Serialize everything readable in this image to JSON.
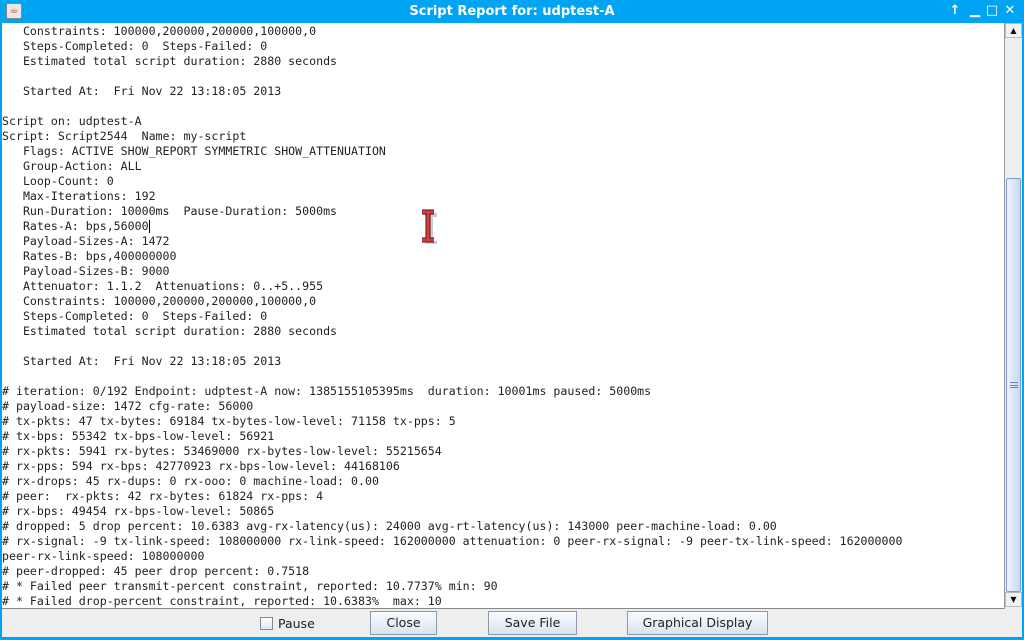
{
  "window": {
    "title": "Script Report for:  udptest-A",
    "buttons": [
      "pin",
      "minimize",
      "maximize",
      "close"
    ]
  },
  "report_lines": [
    "   Constraints: 100000,200000,200000,100000,0",
    "   Steps-Completed: 0  Steps-Failed: 0",
    "   Estimated total script duration: 2880 seconds",
    "",
    "   Started At:  Fri Nov 22 13:18:05 2013",
    "",
    "Script on: udptest-A",
    "Script: Script2544  Name: my-script",
    "   Flags: ACTIVE SHOW_REPORT SYMMETRIC SHOW_ATTENUATION",
    "   Group-Action: ALL",
    "   Loop-Count: 0",
    "   Max-Iterations: 192",
    "   Run-Duration: 10000ms  Pause-Duration: 5000ms",
    "   Rates-A: bps,56000",
    "   Payload-Sizes-A: 1472",
    "   Rates-B: bps,400000000",
    "   Payload-Sizes-B: 9000",
    "   Attenuator: 1.1.2  Attenuations: 0..+5..955",
    "   Constraints: 100000,200000,200000,100000,0",
    "   Steps-Completed: 0  Steps-Failed: 0",
    "   Estimated total script duration: 2880 seconds",
    "",
    "   Started At:  Fri Nov 22 13:18:05 2013",
    "",
    "# iteration: 0/192 Endpoint: udptest-A now: 1385155105395ms  duration: 10001ms paused: 5000ms",
    "# payload-size: 1472 cfg-rate: 56000",
    "# tx-pkts: 47 tx-bytes: 69184 tx-bytes-low-level: 71158 tx-pps: 5",
    "# tx-bps: 55342 tx-bps-low-level: 56921",
    "# rx-pkts: 5941 rx-bytes: 53469000 rx-bytes-low-level: 55215654",
    "# rx-pps: 594 rx-bps: 42770923 rx-bps-low-level: 44168106",
    "# rx-drops: 45 rx-dups: 0 rx-ooo: 0 machine-load: 0.00",
    "# peer:  rx-pkts: 42 rx-bytes: 61824 rx-pps: 4",
    "# rx-bps: 49454 rx-bps-low-level: 50865",
    "# dropped: 5 drop percent: 10.6383 avg-rx-latency(us): 24000 avg-rt-latency(us): 143000 peer-machine-load: 0.00",
    "# rx-signal: -9 tx-link-speed: 108000000 rx-link-speed: 162000000 attenuation: 0 peer-rx-signal: -9 peer-tx-link-speed: 162000000",
    "peer-rx-link-speed: 108000000",
    "# peer-dropped: 45 peer drop percent: 0.7518",
    "# * Failed peer transmit-percent constraint, reported: 10.7737% min: 90",
    "# * Failed drop-percent constraint, reported: 10.6383%  max: 10"
  ],
  "scroll_position_percent": 72,
  "bottom": {
    "pause_label": "Pause",
    "pause_checked": false,
    "close_label": "Close",
    "save_label": "Save File",
    "graph_label": "Graphical Display"
  }
}
